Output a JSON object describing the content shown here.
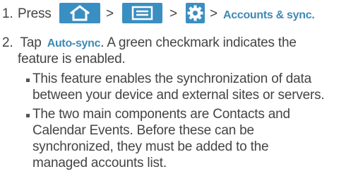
{
  "steps": [
    {
      "number": "1.",
      "parts": {
        "press": "Press",
        "sep1": ">",
        "sep2": ">",
        "sep3": ">",
        "target": "Accounts & sync."
      },
      "icons": [
        "home-icon",
        "menu-icon",
        "settings-icon"
      ]
    },
    {
      "number": "2.",
      "line1_pre": "Tap",
      "line1_bold": "Auto-sync",
      "line1_post": ". A green checkmark indicates the",
      "line2": "feature is enabled.",
      "bullets": [
        {
          "lines": [
            "This feature enables the synchronization of data",
            "between your device and external sites or servers."
          ]
        },
        {
          "lines": [
            "The two main components are Contacts and",
            "Calendar Events. Before these can be",
            "synchronized, they must be added to the",
            "managed accounts list."
          ]
        }
      ]
    }
  ],
  "colors": {
    "icon_background": "#3a8fc2",
    "accent_text": "#3f8ab6",
    "body_text": "#444444"
  }
}
